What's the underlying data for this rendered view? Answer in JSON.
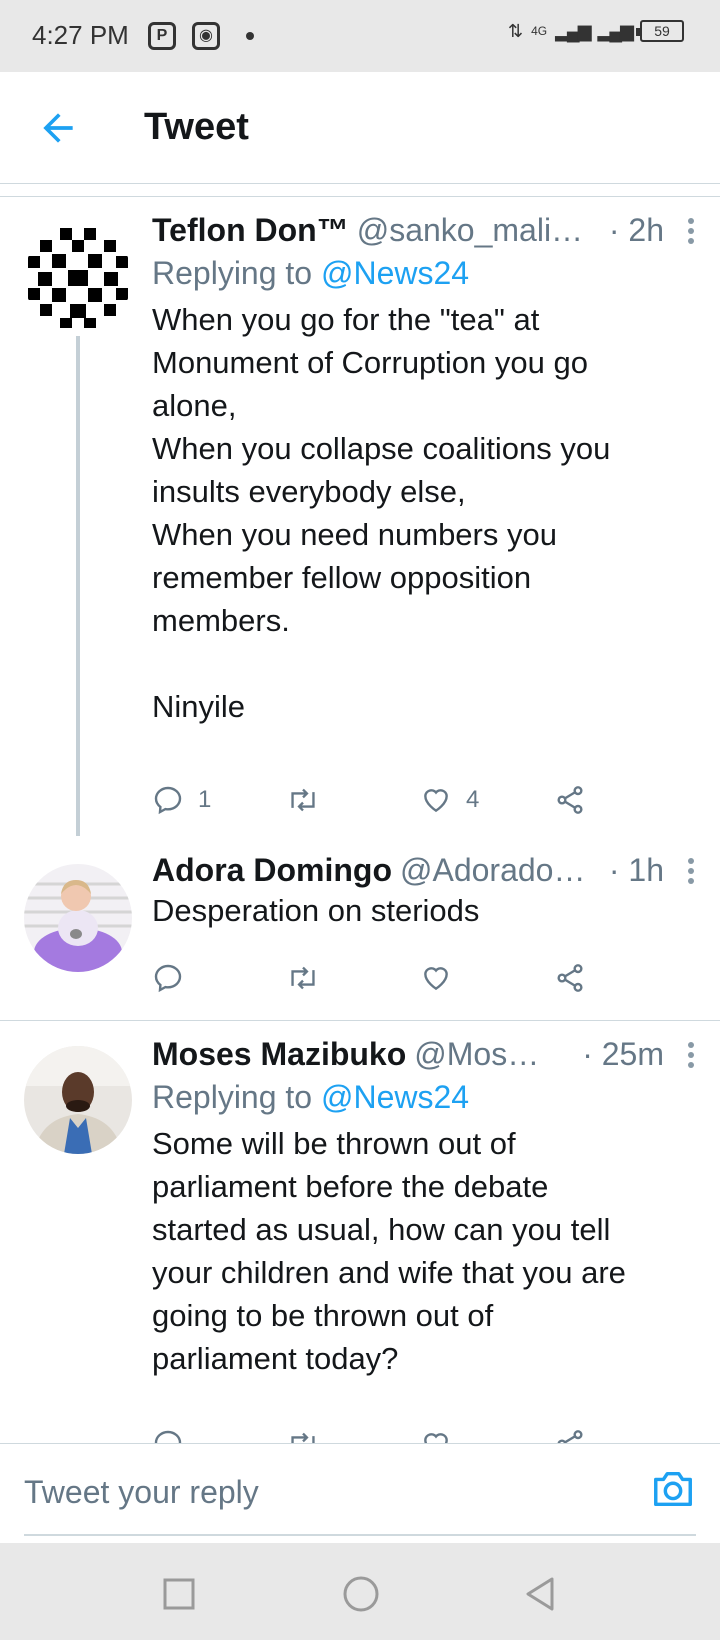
{
  "status_bar": {
    "time": "4:27 PM",
    "network": "4G",
    "battery": "59"
  },
  "header": {
    "title": "Tweet",
    "accent_color": "#1da1f2"
  },
  "tweets": [
    {
      "name": "Teflon Don™",
      "handle": "@sanko_mali…",
      "time": "· 2h",
      "reply_prefix": "Replying to",
      "reply_mention": "@News24",
      "text": "When you go for the \"tea\" at\nMonument of Corruption you go\nalone,\nWhen you collapse coalitions you\ninsults everybody else,\nWhen you need numbers you\nremember fellow opposition\nmembers.\n\nNinyile",
      "replies": "1",
      "retweets": "",
      "likes": "4"
    },
    {
      "name": "Adora Domingo",
      "handle": "@Adorado…",
      "time": "· 1h",
      "text": "Desperation on steriods",
      "replies": "",
      "retweets": "",
      "likes": ""
    },
    {
      "name": "Moses Mazibuko",
      "handle": "@Mos…",
      "time": "· 25m",
      "reply_prefix": "Replying to",
      "reply_mention": "@News24",
      "text": "Some will be thrown out of\nparliament before the debate\nstarted as usual, how can you tell\nyour children and wife that you are\ngoing to be thrown out of\nparliament today?"
    }
  ],
  "reply_bar": {
    "placeholder": "Tweet your reply"
  }
}
